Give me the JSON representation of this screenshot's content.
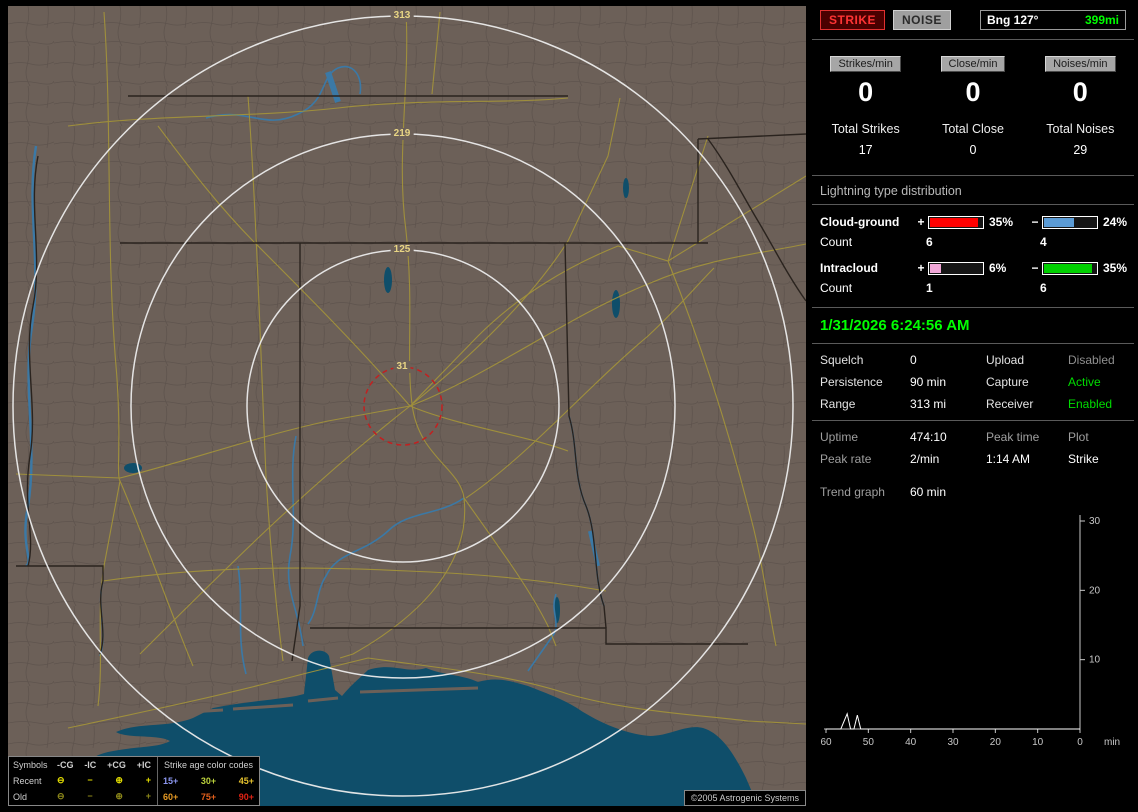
{
  "map": {
    "ring_labels": {
      "outer": "313",
      "middle": "219",
      "inner": "125",
      "close": "31"
    },
    "copyright": "©2005 Astrogenic Systems",
    "legend": {
      "symbols_header": "Symbols",
      "columns": [
        "-CG",
        "-IC",
        "+CG",
        "+IC"
      ],
      "recent_label": "Recent",
      "old_label": "Old",
      "symbols": [
        "⊖",
        "−",
        "⊕",
        "+"
      ],
      "recent_color": "#e6e000",
      "old_color": "#8f8a1a",
      "age_header": "Strike age color codes",
      "ages_recent": [
        {
          "t": "15+",
          "c": "#8c97f0"
        },
        {
          "t": "30+",
          "c": "#bcd23c"
        },
        {
          "t": "45+",
          "c": "#e6c22e"
        }
      ],
      "ages_old": [
        {
          "t": "60+",
          "c": "#e69a23"
        },
        {
          "t": "75+",
          "c": "#e4601c"
        },
        {
          "t": "90+",
          "c": "#e22314"
        }
      ]
    }
  },
  "panel": {
    "strike_label": "STRIKE",
    "noise_label": "NOISE",
    "bearing": "Bng 127°",
    "bearing_range": "399mi",
    "rates": [
      {
        "label": "Strikes/min",
        "value": "0"
      },
      {
        "label": "Close/min",
        "value": "0"
      },
      {
        "label": "Noises/min",
        "value": "0"
      }
    ],
    "totals": [
      {
        "label": "Total Strikes",
        "value": "17"
      },
      {
        "label": "Total Close",
        "value": "0"
      },
      {
        "label": "Total Noises",
        "value": "29"
      }
    ],
    "distribution": {
      "title": "Lightning type distribution",
      "count_label": "Count",
      "rows": [
        {
          "name": "Cloud-ground",
          "plus_sign": "+",
          "minus_sign": "−",
          "pos_pct": "35%",
          "neg_pct": "24%",
          "pos_count": "6",
          "neg_count": "4",
          "pos_color": "#ff0000",
          "neg_color": "#5b9bd5",
          "pos_fill": "88%",
          "neg_fill": "55%"
        },
        {
          "name": "Intracloud",
          "plus_sign": "+",
          "minus_sign": "−",
          "pos_pct": "6%",
          "neg_pct": "35%",
          "pos_count": "1",
          "neg_count": "6",
          "pos_color": "#f2a7d8",
          "neg_color": "#00d000",
          "pos_fill": "20%",
          "neg_fill": "88%"
        }
      ]
    },
    "datetime": "1/31/2026 6:24:56 AM",
    "settings": {
      "rows": [
        {
          "label": "Squelch",
          "value": "0",
          "label2": "Upload",
          "value2": "Disabled",
          "status_color": "#8f8f8f"
        },
        {
          "label": "Persistence",
          "value": "90 min",
          "label2": "Capture",
          "value2": "Active",
          "status_color": "#00dd00"
        },
        {
          "label": "Range",
          "value": "313 mi",
          "label2": "Receiver",
          "value2": "Enabled",
          "status_color": "#00dd00"
        }
      ]
    },
    "status": {
      "uptime_label": "Uptime",
      "uptime_value": "474:10",
      "peak_time_label": "Peak time",
      "plot_label": "Plot",
      "peak_rate_label": "Peak rate",
      "peak_rate_value": "2/min",
      "peak_time_value": "1:14 AM",
      "plot_value": "Strike",
      "trend_label": "Trend graph",
      "trend_value": "60 min"
    }
  },
  "chart_data": {
    "type": "line",
    "title": "Trend graph (strikes per minute, last 60 min)",
    "x_unit_label": "min",
    "x_ticks": [
      60,
      50,
      40,
      30,
      20,
      10,
      0
    ],
    "y_ticks": [
      10,
      20,
      30
    ],
    "ylim": [
      0,
      30
    ],
    "xlim_minutes_ago": [
      60,
      0
    ],
    "series": [
      {
        "name": "Strike",
        "points": [
          [
            60,
            0
          ],
          [
            56.5,
            0
          ],
          [
            55,
            2.2
          ],
          [
            54.2,
            0
          ],
          [
            53.4,
            0
          ],
          [
            52.6,
            2.0
          ],
          [
            51.8,
            0
          ],
          [
            40,
            0
          ],
          [
            30,
            0
          ],
          [
            20,
            0
          ],
          [
            10,
            0
          ],
          [
            0,
            0
          ]
        ]
      }
    ]
  }
}
